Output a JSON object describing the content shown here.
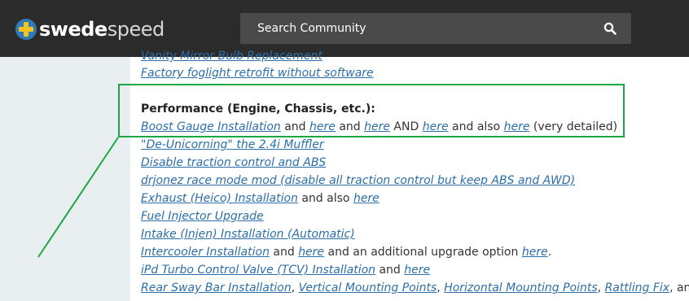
{
  "header": {
    "logo": {
      "part1": "swede",
      "part2": "speed"
    },
    "search": {
      "placeholder": "Search Community"
    }
  },
  "content": {
    "cut_link": "Vanity Mirror Bulb Replacement",
    "foglight_link": "Factory foglight retrofit without software",
    "section_heading": "Performance (Engine, Chassis, etc.):",
    "boost": {
      "link": "Boost Gauge Installation",
      "t1": " and ",
      "l2": "here",
      "t2": " and ",
      "l3": "here",
      "t3": " AND ",
      "l4": "here",
      "t4": " and also ",
      "l5": "here",
      "t5": " (very detailed)"
    },
    "muffler_link": "\"De-Unicorning\" the 2.4i Muffler",
    "traction_link": "Disable traction control and ABS",
    "drjonez_link": "drjonez race mode mod (disable all traction control but keep ABS and AWD)",
    "exhaust": {
      "link": "Exhaust (Heico) Installation",
      "t1": " and also ",
      "l2": "here"
    },
    "fuel_link": "Fuel Injector Upgrade",
    "intake_link": "Intake (Injen) Installation (Automatic)",
    "intercooler": {
      "link": "Intercooler Installation",
      "t1": " and ",
      "l2": "here",
      "t2": " and an additional upgrade option ",
      "l3": "here",
      "t3": "."
    },
    "ipd": {
      "link": "iPd Turbo Control Valve (TCV) Installation",
      "t1": " and ",
      "l2": "here"
    },
    "sway": {
      "link": "Rear Sway Bar Installation",
      "t1": ", ",
      "l2": "Vertical Mounting Points",
      "t2": ", ",
      "l3": "Horizontal Mounting Points",
      "t3": ", ",
      "l4": "Rattling Fix",
      "t4": ", and"
    }
  },
  "colors": {
    "topbar": "#2b2b2b",
    "link": "#2c6fa8",
    "highlight": "#1aa845",
    "logo_blue": "#2f7ab8",
    "logo_yellow": "#f3c21c"
  }
}
